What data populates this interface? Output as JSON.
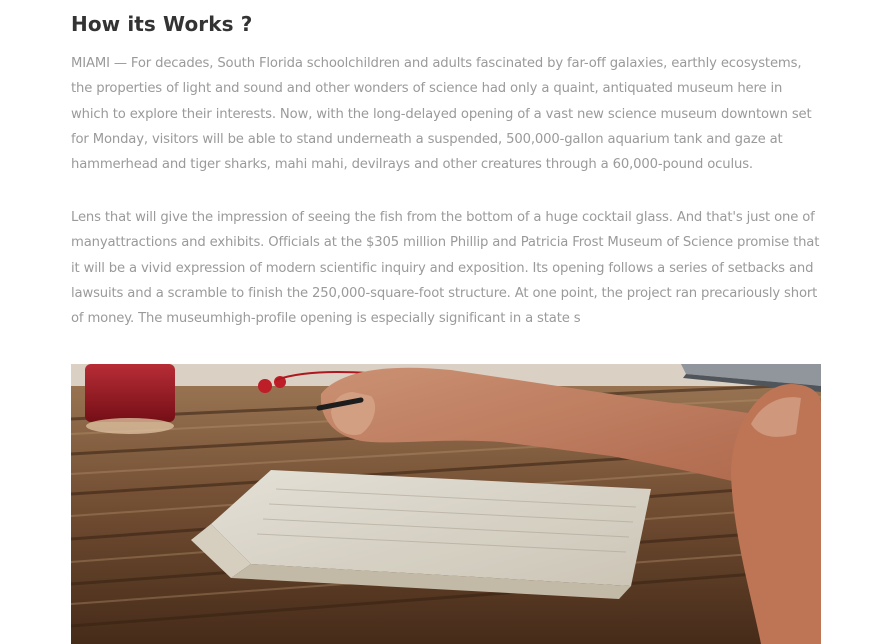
{
  "section": {
    "heading": "How its Works ?",
    "paragraphs": [
      "MIAMI — For decades, South Florida schoolchildren and adults fascinated by far-off galaxies, earthly ecosystems, the properties of light and sound and other wonders of science had only a quaint, antiquated museum here in which to explore their interests. Now, with the long-delayed opening of a vast new science museum downtown set for Monday, visitors will be able to stand underneath a suspended, 500,000-gallon aquarium tank and gaze at hammerhead and tiger sharks, mahi mahi, devilrays and other creatures through a 60,000-pound oculus.",
      "Lens that will give the impression of seeing the fish from the bottom of a huge cocktail glass. And that's just one of manyattractions and exhibits. Officials at the $305 million Phillip and Patricia Frost Museum of Science promise that it will be a vivid expression of modern scientific inquiry and exposition. Its opening follows a series of setbacks and lawsuits and a scramble to finish the 250,000-square-foot structure. At one point, the project ran precariously short of money. The museumhigh-profile opening is especially significant in a state s"
    ]
  },
  "image": {
    "subject": "hands-writing-in-notebook-on-wooden-table"
  }
}
